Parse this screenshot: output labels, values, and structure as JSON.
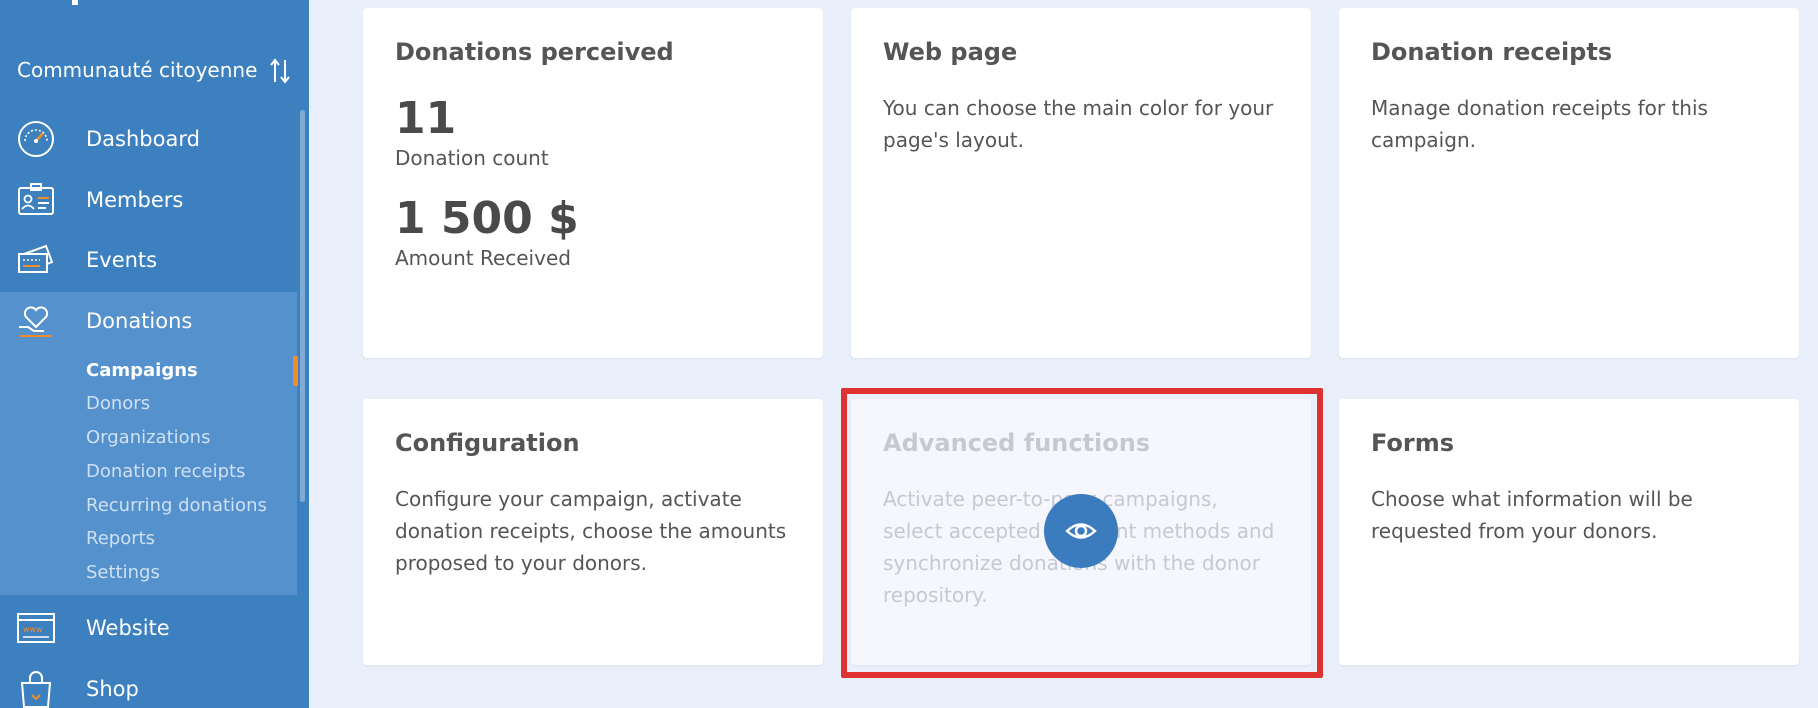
{
  "sidebar": {
    "org_name": "Communauté citoyenne",
    "nav": [
      {
        "label": "Dashboard",
        "icon": "speedometer-icon"
      },
      {
        "label": "Members",
        "icon": "id-card-icon"
      },
      {
        "label": "Events",
        "icon": "ticket-icon"
      },
      {
        "label": "Donations",
        "icon": "heart-hand-icon"
      },
      {
        "label": "Website",
        "icon": "browser-window-icon"
      },
      {
        "label": "Shop",
        "icon": "shopping-bag-icon"
      }
    ],
    "donations_sub": [
      {
        "label": "Campaigns"
      },
      {
        "label": "Donors"
      },
      {
        "label": "Organizations"
      },
      {
        "label": "Donation receipts"
      },
      {
        "label": "Recurring donations"
      },
      {
        "label": "Reports"
      },
      {
        "label": "Settings"
      }
    ],
    "accent_color": "#f28c28"
  },
  "cards": {
    "donations_perceived": {
      "title": "Donations perceived",
      "count_value": "11",
      "count_label": "Donation count",
      "amount_value": "1 500 $",
      "amount_label": "Amount Received"
    },
    "web_page": {
      "title": "Web page",
      "text": "You can choose the main color for your page's layout."
    },
    "donation_receipts": {
      "title": "Donation receipts",
      "text": "Manage donation receipts for this campaign."
    },
    "configuration": {
      "title": "Configuration",
      "text": "Configure your campaign, activate donation receipts, choose the amounts proposed to your donors."
    },
    "advanced_functions": {
      "title": "Advanced functions",
      "text": "Activate peer-to-peer campaigns, select accepted payment methods and synchronize donations with the donor repository."
    },
    "forms": {
      "title": "Forms",
      "text": "Choose what information will be requested from your donors."
    }
  },
  "colors": {
    "sidebar_bg": "#3d80c0",
    "sidebar_active": "#5591cc",
    "highlight_border": "#e03131",
    "eye_button": "#3b7cbf"
  }
}
